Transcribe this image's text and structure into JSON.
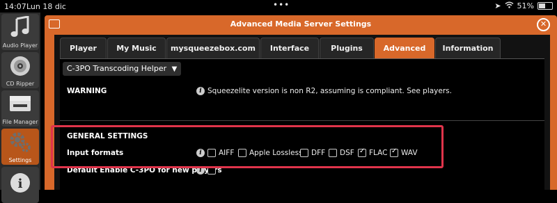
{
  "status_bar": {
    "time": "14:07",
    "date": "Lun 18 dic",
    "battery": "51%"
  },
  "sidebar": {
    "items": [
      {
        "label": "Audio Player",
        "icon": "music-note-icon"
      },
      {
        "label": "CD Ripper",
        "icon": "cd-icon"
      },
      {
        "label": "File Manager",
        "icon": "drive-icon"
      },
      {
        "label": "Settings",
        "icon": "gears-icon",
        "active": true
      },
      {
        "label": "",
        "icon": "info-icon"
      }
    ]
  },
  "window": {
    "title": "Advanced Media Server Settings",
    "accent": "#d8682a"
  },
  "tabs": [
    {
      "label": "Player"
    },
    {
      "label": "My Music"
    },
    {
      "label": "mysqueezebox.com"
    },
    {
      "label": "Interface"
    },
    {
      "label": "Plugins"
    },
    {
      "label": "Advanced",
      "active": true
    },
    {
      "label": "Information"
    }
  ],
  "settings": {
    "selected_page": "C-3PO Transcoding Helper",
    "warning_label": "WARNING",
    "warning_text": "Squeezelite version is non R2, assuming is compliant. See players.",
    "general_heading": "GENERAL SETTINGS",
    "input_formats_label": "Input formats",
    "formats": [
      {
        "label": "AIFF",
        "checked": false
      },
      {
        "label": "Apple Lossless",
        "checked": false
      },
      {
        "label": "DFF",
        "checked": false
      },
      {
        "label": "DSF",
        "checked": false
      },
      {
        "label": "FLAC",
        "checked": true
      },
      {
        "label": "WAV",
        "checked": true
      }
    ],
    "default_enable_label": "Default Enable C-3PO for new players",
    "default_enable_checked": false
  }
}
